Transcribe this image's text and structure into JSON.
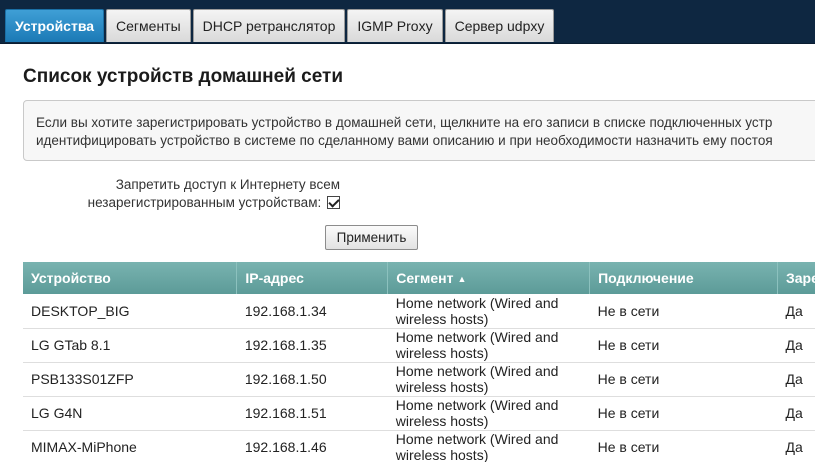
{
  "tabs": [
    {
      "label": "Устройства",
      "active": true
    },
    {
      "label": "Сегменты",
      "active": false
    },
    {
      "label": "DHCP ретранслятор",
      "active": false
    },
    {
      "label": "IGMP Proxy",
      "active": false
    },
    {
      "label": "Сервер udpxy",
      "active": false
    }
  ],
  "main": {
    "title": "Список устройств домашней сети",
    "info_line1": "Если вы хотите зарегистрировать устройство в домашней сети, щелкните на его записи в списке подключенных устр",
    "info_line2": "идентифицировать устройство в системе по сделанному вами описанию и при необходимости назначить ему постоя",
    "option_line1": "Запретить доступ к Интернету всем",
    "option_line2": "незарегистрированным устройствам:",
    "option_checked": true,
    "apply_label": "Применить"
  },
  "table": {
    "headers": [
      "Устройство",
      "IP-адрес",
      "Сегмент",
      "Подключение",
      "Заре"
    ],
    "sort_column": "Сегмент",
    "sort_direction": "ascending",
    "rows": [
      [
        "DESKTOP_BIG",
        "192.168.1.34",
        "Home network (Wired and wireless hosts)",
        "Не в сети",
        "Да"
      ],
      [
        "LG GTab 8.1",
        "192.168.1.35",
        "Home network (Wired and wireless hosts)",
        "Не в сети",
        "Да"
      ],
      [
        "PSB133S01ZFP",
        "192.168.1.50",
        "Home network (Wired and wireless hosts)",
        "Не в сети",
        "Да"
      ],
      [
        "LG G4N",
        "192.168.1.51",
        "Home network (Wired and wireless hosts)",
        "Не в сети",
        "Да"
      ],
      [
        "MIMAX-MiPhone",
        "192.168.1.46",
        "Home network (Wired and wireless hosts)",
        "Не в сети",
        "Да"
      ]
    ]
  },
  "colors": {
    "top_bar": "#0e2741",
    "active_tab": "#1b79b5",
    "table_header": "#5c9b98"
  }
}
